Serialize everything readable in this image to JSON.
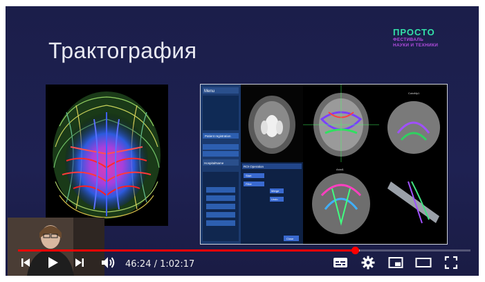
{
  "slide": {
    "title": "Трактография",
    "logo": {
      "line1": "ПРОСТО",
      "line2": "ФЕСТИВАЛЬ",
      "line3": "НАУКИ И ТЕХНИКИ"
    }
  },
  "screenshot": {
    "menu_label": "Menu",
    "patient_registration": "Patient registration",
    "hospital_name": "HospitalName",
    "coronal_label": "CutoMp1",
    "axial_label": "Axial1",
    "dialog_title": "ROI Operation",
    "buttons": [
      "Start",
      "Filter",
      "Merge",
      "Undo",
      "Close"
    ]
  },
  "player": {
    "current_time": "46:24",
    "separator": " / ",
    "duration": "1:02:17",
    "progress": 0.745,
    "buffered": 0.755,
    "colors": {
      "played": "#ff0000",
      "icon": "#ffffff"
    },
    "icons": {
      "previous": "previous-icon",
      "play": "play-icon",
      "next": "next-icon",
      "volume": "volume-icon",
      "subtitles": "subtitles-icon",
      "settings": "gear-icon",
      "miniplayer": "miniplayer-icon",
      "theater": "theater-icon",
      "fullscreen": "fullscreen-icon"
    }
  }
}
